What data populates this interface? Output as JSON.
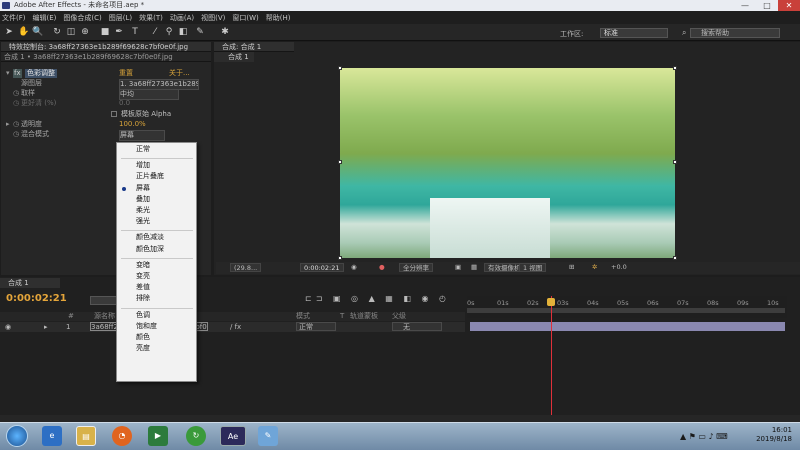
{
  "window": {
    "title": "Adobe After Effects - 未命名项目.aep *",
    "min": "—",
    "max": "□",
    "close": "✕"
  },
  "menu": [
    "文件(F)",
    "编辑(E)",
    "图像合成(C)",
    "图层(L)",
    "效果(T)",
    "动画(A)",
    "视图(V)",
    "窗口(W)",
    "帮助(H)"
  ],
  "toolbar": {
    "workspace_label": "工作区:",
    "workspace_value": "标准",
    "help_search": "搜索帮助"
  },
  "effect_controls": {
    "tab": "特效控制台: 3a68ff27363e1b289f69628c7bf0e0f.jpg",
    "comp_ref": "合成 1 • 3a68ff27363e1b289f69628c7bf0e0f.jpg",
    "effect_name": "色彩调整",
    "reset": "重置",
    "about": "关于...",
    "props": [
      {
        "name": "源图层",
        "value": "1. 3a68ff27363e1b289f69628c7bf0e0f"
      },
      {
        "name": "取样",
        "value": "中均"
      },
      {
        "name": "更好清 (%)",
        "value": "0.0"
      },
      {
        "name": "",
        "value": "模板原始 Alpha"
      },
      {
        "name": "透明度",
        "value": "100.0%"
      },
      {
        "name": "混合模式",
        "value": "屏幕"
      }
    ]
  },
  "composition": {
    "tab": "合成: 合成 1",
    "subtab": "合成 1",
    "zoom": "(29.8...",
    "time": "0:00:02:21",
    "resolution": "全分辨率",
    "camera": "有效摄像机",
    "views": "1 视图",
    "exposure": "+0.0"
  },
  "timeline": {
    "tab": "合成 1",
    "timecode": "0:00:02:21",
    "headers": [
      "#",
      "源名称",
      "模式",
      "T",
      "轨道蒙板",
      "父级"
    ],
    "layer": {
      "index": "1",
      "name": "3a68ff27363e1b289f69628c7bf0e0f.jpg",
      "mode": "正常",
      "parent": "无"
    },
    "ruler": [
      "0s",
      "01s",
      "02s",
      "03s",
      "04s",
      "05s",
      "06s",
      "07s",
      "08s",
      "09s",
      "10s"
    ],
    "playhead_seconds": 2.7
  },
  "blend_menu": {
    "selected": "屏幕",
    "groups": [
      [
        "正常"
      ],
      [
        "增加",
        "正片叠底",
        "屏幕",
        "叠加",
        "柔光",
        "强光"
      ],
      [
        "颜色减淡",
        "颜色加深"
      ],
      [
        "变暗",
        "变亮",
        "差值",
        "排除"
      ],
      [
        "色调",
        "饱和度",
        "颜色",
        "亮度"
      ]
    ]
  },
  "taskbar": {
    "apps": [
      "IE",
      "Explorer",
      "Firefox",
      "Camtasia",
      "360",
      "Ae",
      "Notepad"
    ],
    "time": "16:01",
    "date": "2019/8/18"
  }
}
